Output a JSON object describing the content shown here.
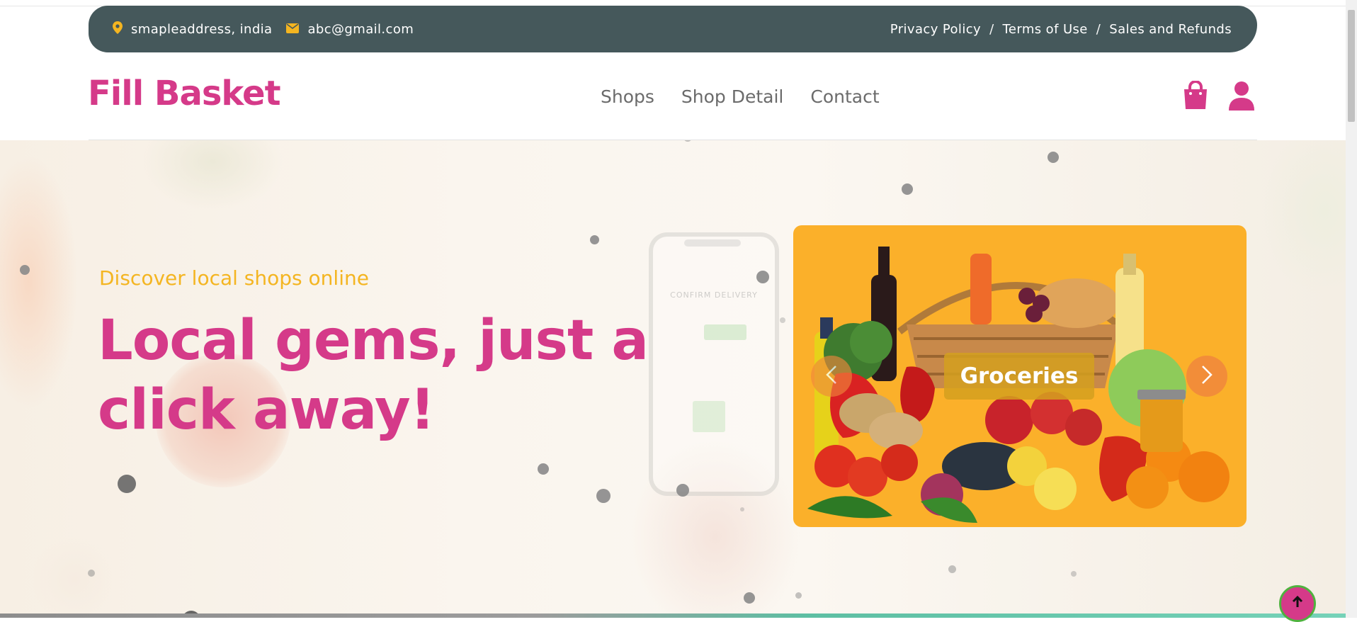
{
  "topbar": {
    "address": "smapleaddress, india",
    "email": "abc@gmail.com",
    "links": [
      "Privacy Policy",
      "Terms of Use",
      "Sales and Refunds"
    ],
    "separator": "/"
  },
  "header": {
    "logo": "Fill Basket",
    "nav": [
      "Shops",
      "Shop Detail",
      "Contact"
    ],
    "icons": [
      "shopping-bag-icon",
      "user-icon"
    ]
  },
  "hero": {
    "subtitle": "Discover local shops online",
    "headline": "Local gems, just a click away!",
    "phone_text": "CONFIRM DELIVERY",
    "carousel": {
      "caption": "Groceries"
    }
  },
  "colors": {
    "brand": "#d53a89",
    "accent": "#f4b521",
    "topbar_bg": "#45585b",
    "carousel_bg": "#fbb02a"
  }
}
